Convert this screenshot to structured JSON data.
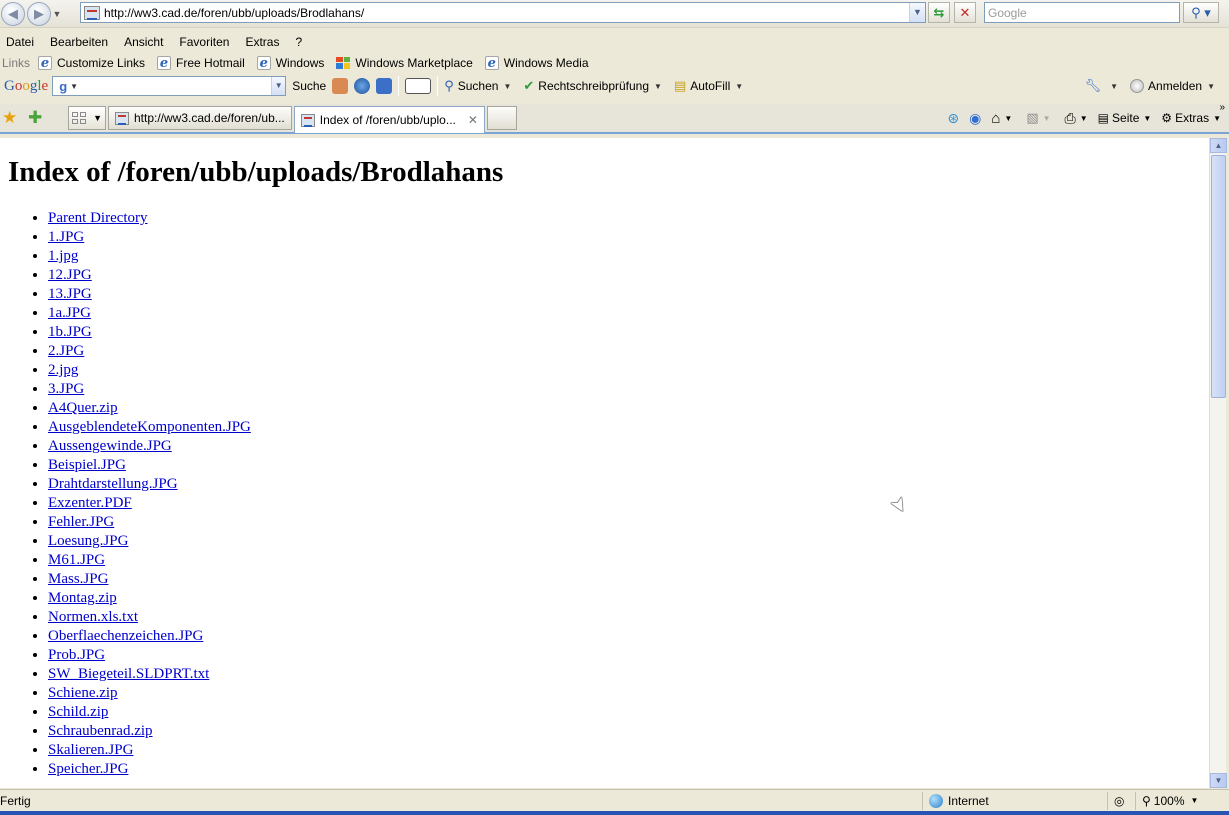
{
  "browser": {
    "address": "http://ww3.cad.de/foren/ubb/uploads/Brodlahans/",
    "search_placeholder": "Google",
    "menu": [
      "Datei",
      "Bearbeiten",
      "Ansicht",
      "Favoriten",
      "Extras",
      "?"
    ],
    "links_label": "Links",
    "links": [
      "Customize Links",
      "Free Hotmail",
      "Windows",
      "Windows Marketplace",
      "Windows Media"
    ],
    "google": {
      "logo": "Google",
      "search_label": "Suche",
      "suchen": "Suchen",
      "spellcheck": "Rechtschreibprüfung",
      "autofill": "AutoFill",
      "signin": "Anmelden"
    },
    "tabs": [
      {
        "title": "http://ww3.cad.de/foren/ub...",
        "active": false
      },
      {
        "title": "Index of /foren/ubb/uplo...",
        "active": true
      }
    ],
    "tools": {
      "seite": "Seite",
      "extras": "Extras"
    },
    "status": {
      "text": "Fertig",
      "zone": "Internet",
      "zoom": "100%"
    }
  },
  "page": {
    "title": "Index of /foren/ubb/uploads/Brodlahans",
    "files": [
      "Parent Directory",
      "1.JPG",
      "1.jpg",
      "12.JPG",
      "13.JPG",
      "1a.JPG",
      "1b.JPG",
      "2.JPG",
      "2.jpg",
      "3.JPG",
      "A4Quer.zip",
      "AusgeblendeteKomponenten.JPG",
      "Aussengewinde.JPG",
      "Beispiel.JPG",
      "Drahtdarstellung.JPG",
      "Exzenter.PDF",
      "Fehler.JPG",
      "Loesung.JPG",
      "M61.JPG",
      "Mass.JPG",
      "Montag.zip",
      "Normen.xls.txt",
      "Oberflaechenzeichen.JPG",
      "Prob.JPG",
      "SW_Biegeteil.SLDPRT.txt",
      "Schiene.zip",
      "Schild.zip",
      "Schraubenrad.zip",
      "Skalieren.JPG",
      "Speicher.JPG"
    ]
  }
}
